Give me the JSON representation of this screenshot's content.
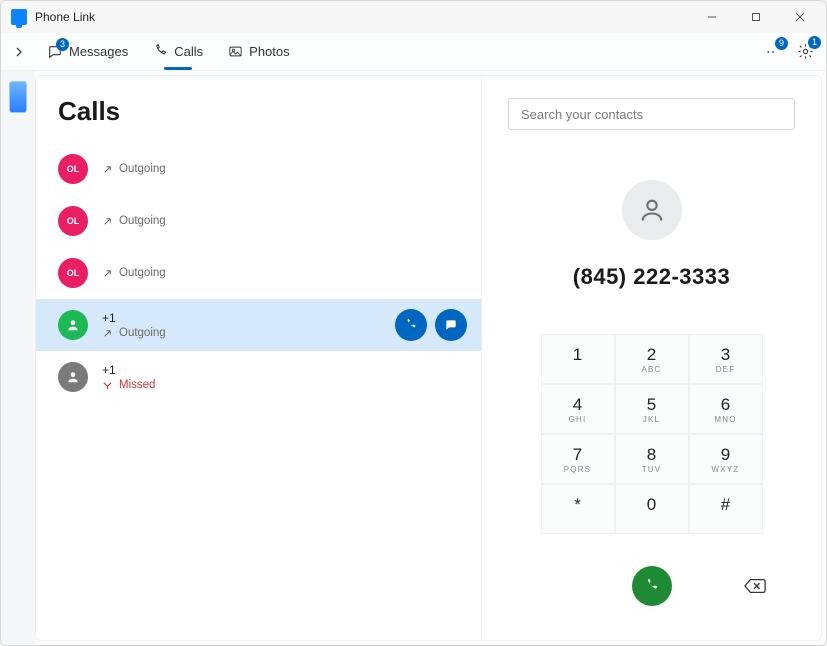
{
  "window": {
    "title": "Phone Link"
  },
  "nav": {
    "messages": {
      "label": "Messages",
      "badge": "3"
    },
    "calls": {
      "label": "Calls"
    },
    "photos": {
      "label": "Photos"
    },
    "notifications_badge": "9",
    "settings_badge": "1"
  },
  "calls_panel": {
    "title": "Calls",
    "items": [
      {
        "initials": "OL",
        "status": "Outgoing",
        "avatar": "pink"
      },
      {
        "initials": "OL",
        "status": "Outgoing",
        "avatar": "pink"
      },
      {
        "initials": "OL",
        "status": "Outgoing",
        "avatar": "pink"
      },
      {
        "label": "+1",
        "status": "Outgoing",
        "avatar": "green",
        "selected": true
      },
      {
        "label": "+1",
        "status": "Missed",
        "avatar": "grey",
        "missed": true
      }
    ]
  },
  "dialer": {
    "search_placeholder": "Search your contacts",
    "display_number": "(845) 222-3333",
    "keys": [
      {
        "d": "1",
        "l": ""
      },
      {
        "d": "2",
        "l": "ABC"
      },
      {
        "d": "3",
        "l": "DEF"
      },
      {
        "d": "4",
        "l": "GHI"
      },
      {
        "d": "5",
        "l": "JKL"
      },
      {
        "d": "6",
        "l": "MNO"
      },
      {
        "d": "7",
        "l": "PQRS"
      },
      {
        "d": "8",
        "l": "TUV"
      },
      {
        "d": "9",
        "l": "WXYZ"
      },
      {
        "d": "*",
        "l": ""
      },
      {
        "d": "0",
        "l": ""
      },
      {
        "d": "#",
        "l": ""
      }
    ]
  }
}
